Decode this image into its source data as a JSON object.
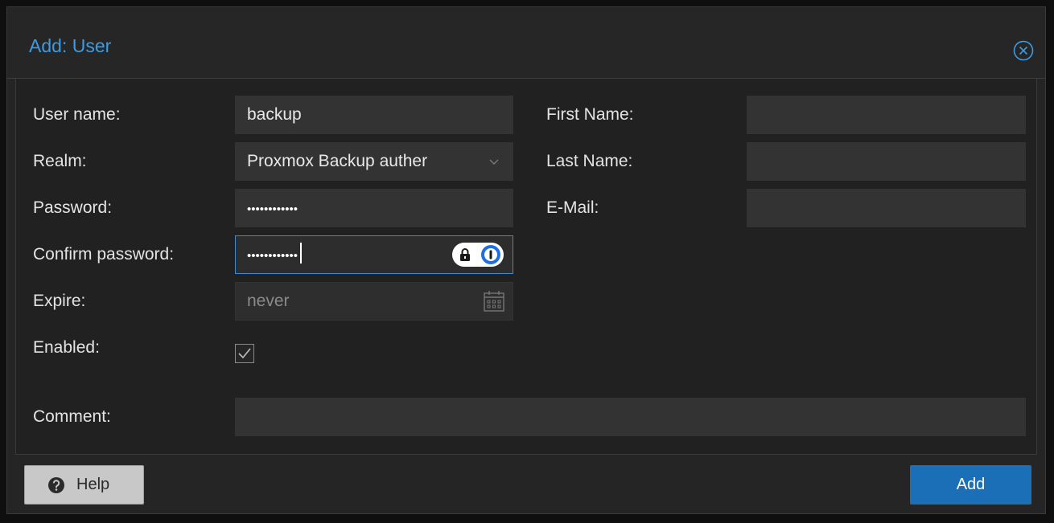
{
  "dialog": {
    "title": "Add: User",
    "close_icon": "close-circle-icon"
  },
  "form": {
    "username": {
      "label": "User name:",
      "value": "backup"
    },
    "realm": {
      "label": "Realm:",
      "value": "Proxmox Backup auther"
    },
    "password": {
      "label": "Password:",
      "value": "••••••••••••"
    },
    "confirm_password": {
      "label": "Confirm password:",
      "value": "••••••••••••"
    },
    "expire": {
      "label": "Expire:",
      "placeholder": "never"
    },
    "enabled": {
      "label": "Enabled:",
      "checked": true
    },
    "first_name": {
      "label": "First Name:",
      "value": ""
    },
    "last_name": {
      "label": "Last Name:",
      "value": ""
    },
    "email": {
      "label": "E-Mail:",
      "value": ""
    },
    "comment": {
      "label": "Comment:",
      "value": ""
    }
  },
  "footer": {
    "help_label": "Help",
    "add_label": "Add"
  },
  "colors": {
    "accent": "#3f9be0",
    "primary_button": "#1a6fb6",
    "focus_border": "#3a8ad4"
  }
}
